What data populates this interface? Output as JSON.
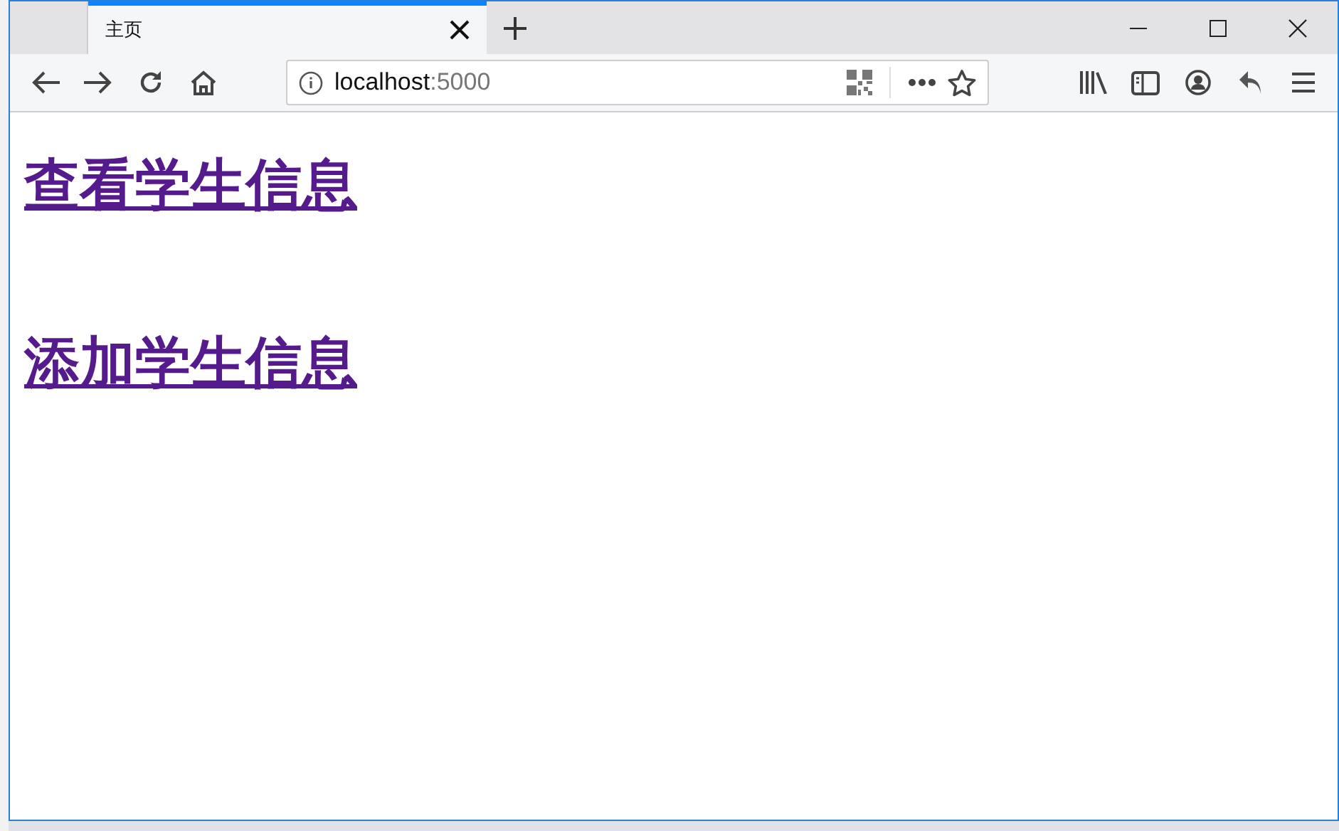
{
  "tabs": [
    {
      "title": "主页",
      "selected": true
    }
  ],
  "address_bar": {
    "host": "localhost",
    "port": ":5000"
  },
  "links": [
    {
      "text": "查看学生信息",
      "visited": true
    },
    {
      "text": "添加学生信息",
      "visited": true
    }
  ]
}
